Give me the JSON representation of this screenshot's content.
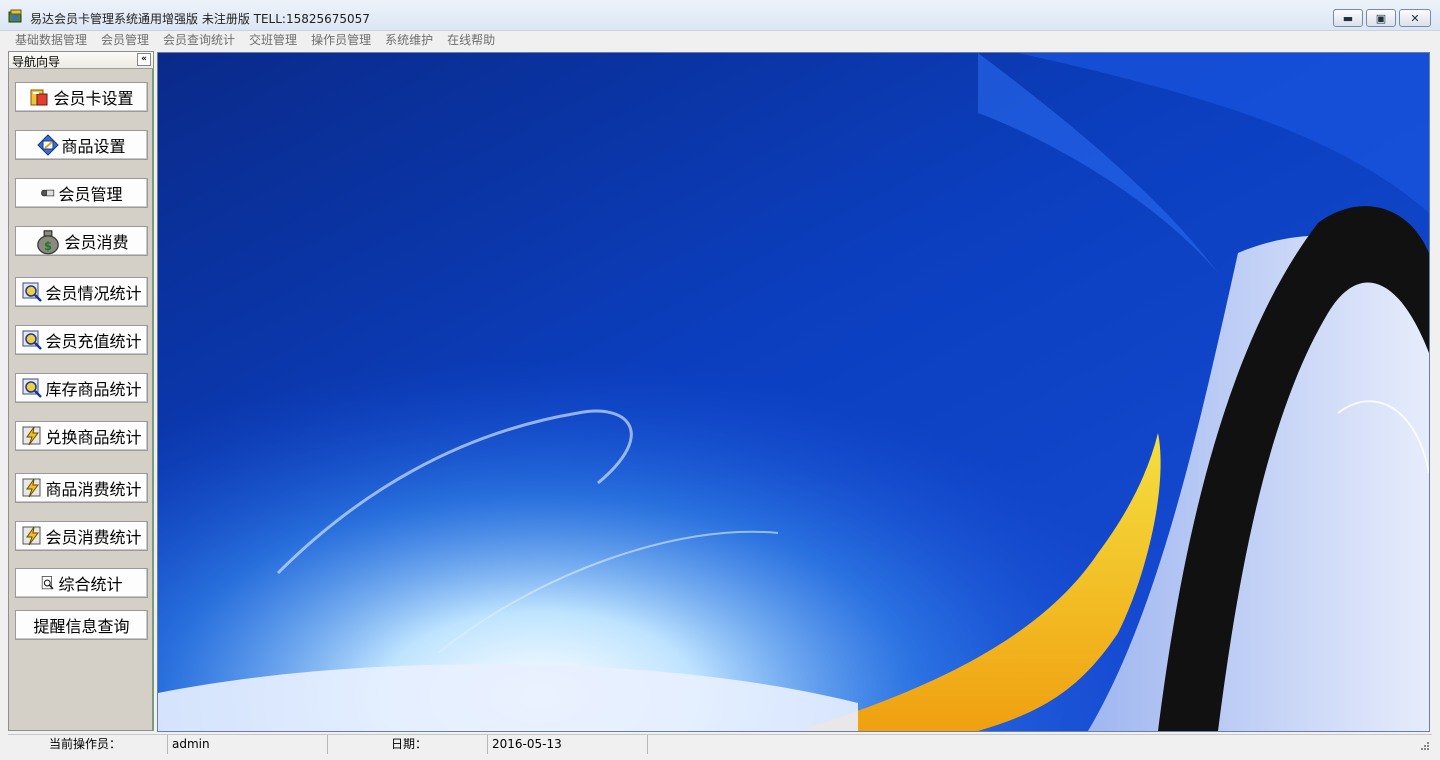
{
  "window": {
    "title": "易达会员卡管理系统通用增强版 未注册版 TELL:15825675057",
    "minimize_glyph": "▬",
    "maximize_glyph": "▣",
    "close_glyph": "✕"
  },
  "menu": [
    {
      "label": "基础数据管理"
    },
    {
      "label": "会员管理"
    },
    {
      "label": "会员查询统计"
    },
    {
      "label": "交班管理"
    },
    {
      "label": "操作员管理"
    },
    {
      "label": "系统维护"
    },
    {
      "label": "在线帮助"
    }
  ],
  "nav": {
    "title": "导航向导",
    "collapse_glyph": "«",
    "buttons": [
      {
        "label": "会员卡设置",
        "icon": "card-settings-icon"
      },
      {
        "label": "商品设置",
        "icon": "product-settings-icon"
      },
      {
        "label": "会员管理",
        "icon": "member-manage-icon"
      },
      {
        "label": "会员消费",
        "icon": "money-bag-icon"
      },
      {
        "label": "会员情况统计",
        "icon": "stats-magnifier-icon"
      },
      {
        "label": "会员充值统计",
        "icon": "stats-magnifier-icon"
      },
      {
        "label": "库存商品统计",
        "icon": "stats-magnifier-icon"
      },
      {
        "label": "兑换商品统计",
        "icon": "lightning-icon"
      },
      {
        "label": "商品消费统计",
        "icon": "lightning-icon"
      },
      {
        "label": "会员消费统计",
        "icon": "lightning-icon"
      },
      {
        "label": "综合统计",
        "icon": "search-doc-icon"
      },
      {
        "label": "提醒信息查询",
        "icon": ""
      }
    ]
  },
  "status": {
    "operator_label": "当前操作员：",
    "operator_value": "admin",
    "date_label": "日期：",
    "date_value": "2016-05-13"
  }
}
